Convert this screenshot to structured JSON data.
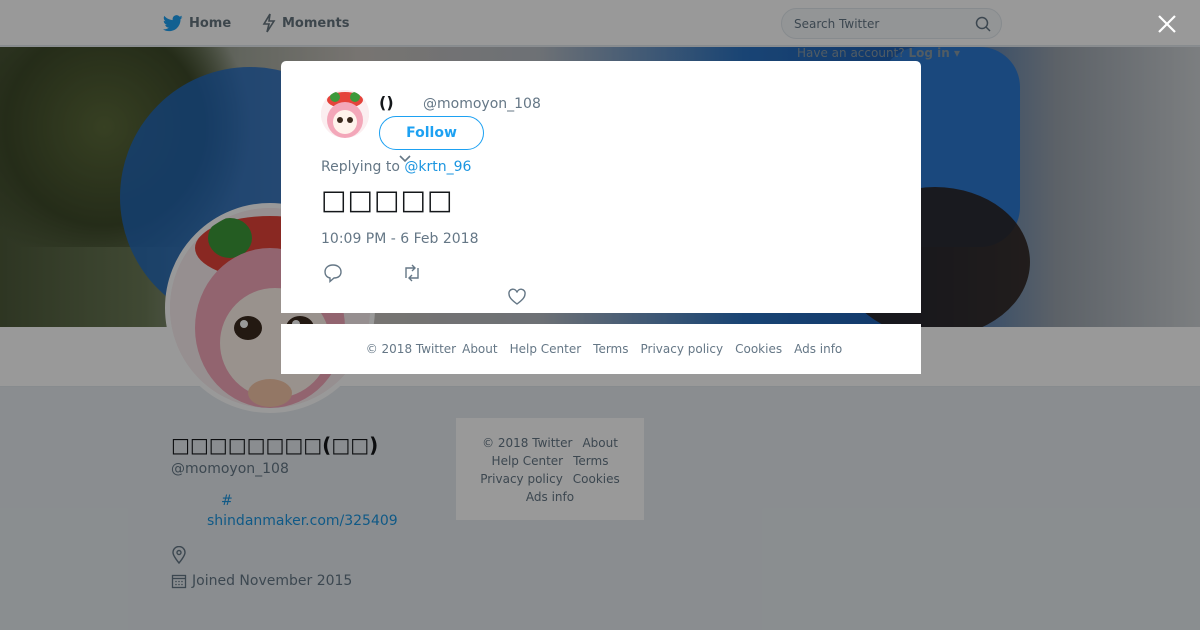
{
  "navbar": {
    "home_label": "Home",
    "moments_label": "Moments",
    "search_placeholder": "Search Twitter",
    "login_prompt": "Have an account?",
    "login_label": "Log in ▾"
  },
  "profile": {
    "name": "□□□□□□□□(□□)",
    "handle": "@momoyon_108",
    "link_line1": "#",
    "link_line2": "shindanmaker.com/325409",
    "joined": "Joined November 2015"
  },
  "side_footer": {
    "copyright": "© 2018 Twitter",
    "about": "About",
    "help": "Help Center",
    "terms": "Terms",
    "privacy": "Privacy policy",
    "cookies": "Cookies",
    "ads": "Ads info"
  },
  "tweet": {
    "fullname": "()",
    "username": "@momoyon_108",
    "follow_label": "Follow",
    "replying_prefix": "Replying to",
    "replying_to": "@krtn_96",
    "text": "□□□□□",
    "timestamp": "10:09 PM - 6 Feb 2018"
  },
  "modal_footer": {
    "copyright": "© 2018 Twitter",
    "about": "About",
    "help": "Help Center",
    "terms": "Terms",
    "privacy": "Privacy policy",
    "cookies": "Cookies",
    "ads": "Ads info"
  },
  "colors": {
    "accent": "#1da1f2",
    "link": "#1b95e0",
    "muted": "#657786"
  },
  "icons": [
    "twitter-bird-icon",
    "lightning-icon",
    "search-icon",
    "close-icon",
    "chevron-down-icon",
    "reply-icon",
    "retweet-icon",
    "heart-icon",
    "location-icon",
    "calendar-icon"
  ]
}
